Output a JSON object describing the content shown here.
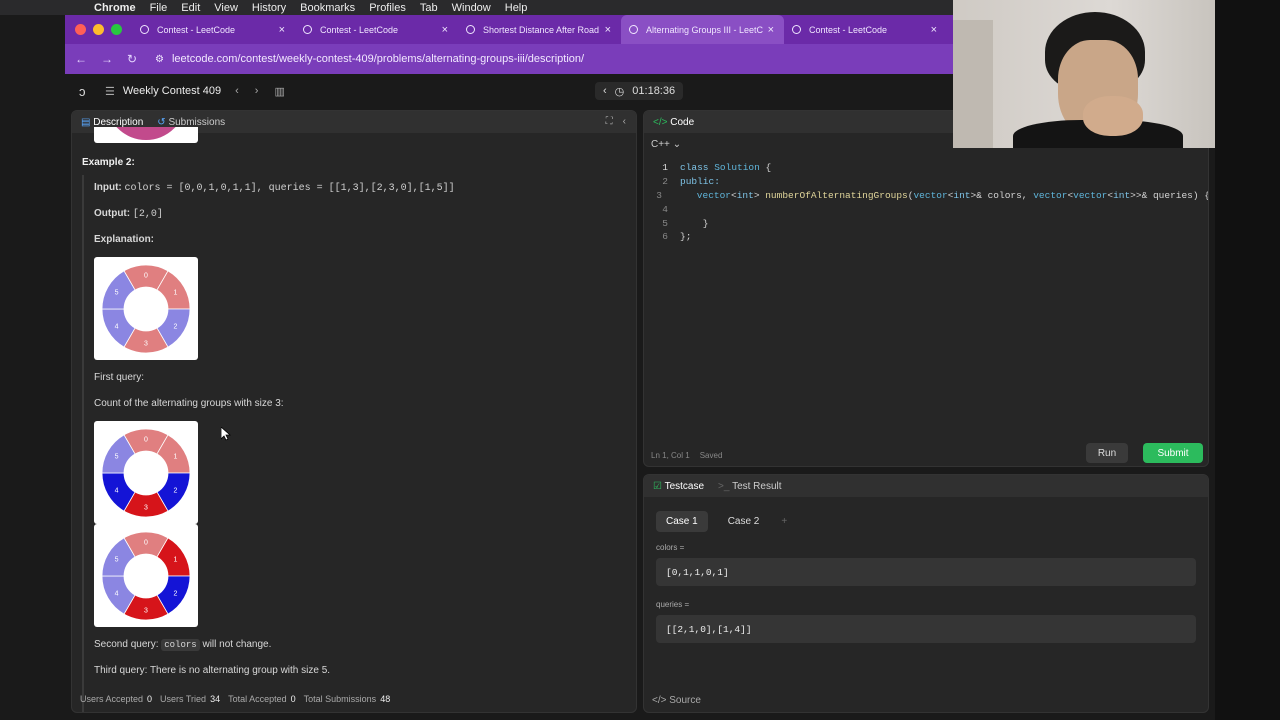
{
  "menubar": {
    "app": "Chrome",
    "items": [
      "File",
      "Edit",
      "View",
      "History",
      "Bookmarks",
      "Profiles",
      "Tab",
      "Window",
      "Help"
    ]
  },
  "tabs": [
    {
      "label": "Contest - LeetCode",
      "active": false
    },
    {
      "label": "Contest - LeetCode",
      "active": false
    },
    {
      "label": "Shortest Distance After Road",
      "active": false
    },
    {
      "label": "Alternating Groups III - LeetC",
      "active": true
    },
    {
      "label": "Contest - LeetCode",
      "active": false
    }
  ],
  "address": {
    "url": "leetcode.com/contest/weekly-contest-409/problems/alternating-groups-iii/description/"
  },
  "contestbar": {
    "title": "Weekly Contest 409",
    "timer": "01:18:36"
  },
  "description": {
    "tabs": {
      "description": "Description",
      "submissions": "Submissions"
    },
    "example_heading": "Example 2:",
    "input_label": "Input:",
    "input_value": "colors = [0,0,1,0,1,1], queries = [[1,3],[2,3,0],[1,5]]",
    "output_label": "Output:",
    "output_value": "[2,0]",
    "explanation_label": "Explanation:",
    "first_query": "First query:",
    "count_text": "Count of the alternating groups with size 3:",
    "second_query_pre": "Second query:",
    "second_query_code": "colors",
    "second_query_post": "will not change.",
    "third_query": "Third query: There is no alternating group with size 5."
  },
  "stats": {
    "users_accepted_label": "Users Accepted",
    "users_accepted": "0",
    "users_tried_label": "Users Tried",
    "users_tried": "34",
    "total_accepted_label": "Total Accepted",
    "total_accepted": "0",
    "total_submissions_label": "Total Submissions",
    "total_submissions": "48"
  },
  "code": {
    "tab": "Code",
    "lang": "C++",
    "lines": [
      {
        "n": "1",
        "text": "class Solution {"
      },
      {
        "n": "2",
        "text": "public:"
      },
      {
        "n": "3",
        "text": "    vector<int> numberOfAlternatingGroups(vector<int>& colors, vector<vector<int>>& queries) {"
      },
      {
        "n": "4",
        "text": ""
      },
      {
        "n": "5",
        "text": "    }"
      },
      {
        "n": "6",
        "text": "};"
      }
    ],
    "status": "Ln 1, Col 1",
    "saved": "Saved",
    "run": "Run",
    "submit": "Submit"
  },
  "testcase": {
    "tab_testcase": "Testcase",
    "tab_result": "Test Result",
    "case1": "Case 1",
    "case2": "Case 2",
    "colors_label": "colors =",
    "colors_value": "[0,1,1,0,1]",
    "queries_label": "queries =",
    "queries_value": "[[2,1,0],[1,4]]",
    "source": "Source"
  },
  "wheels": [
    {
      "name": "example-wheel",
      "segments": [
        "#e07f80",
        "#e07f80",
        "#8b86e2",
        "#e07f80",
        "#8b86e2",
        "#8b86e2"
      ]
    },
    {
      "name": "query1-wheel-a",
      "segments": [
        "#e07f80",
        "#e07f80",
        "#1414d6",
        "#d6141a",
        "#1414d6",
        "#8b86e2"
      ]
    },
    {
      "name": "query1-wheel-b",
      "segments": [
        "#e07f80",
        "#d6141a",
        "#1414d6",
        "#d6141a",
        "#8b86e2",
        "#8b86e2"
      ]
    }
  ]
}
